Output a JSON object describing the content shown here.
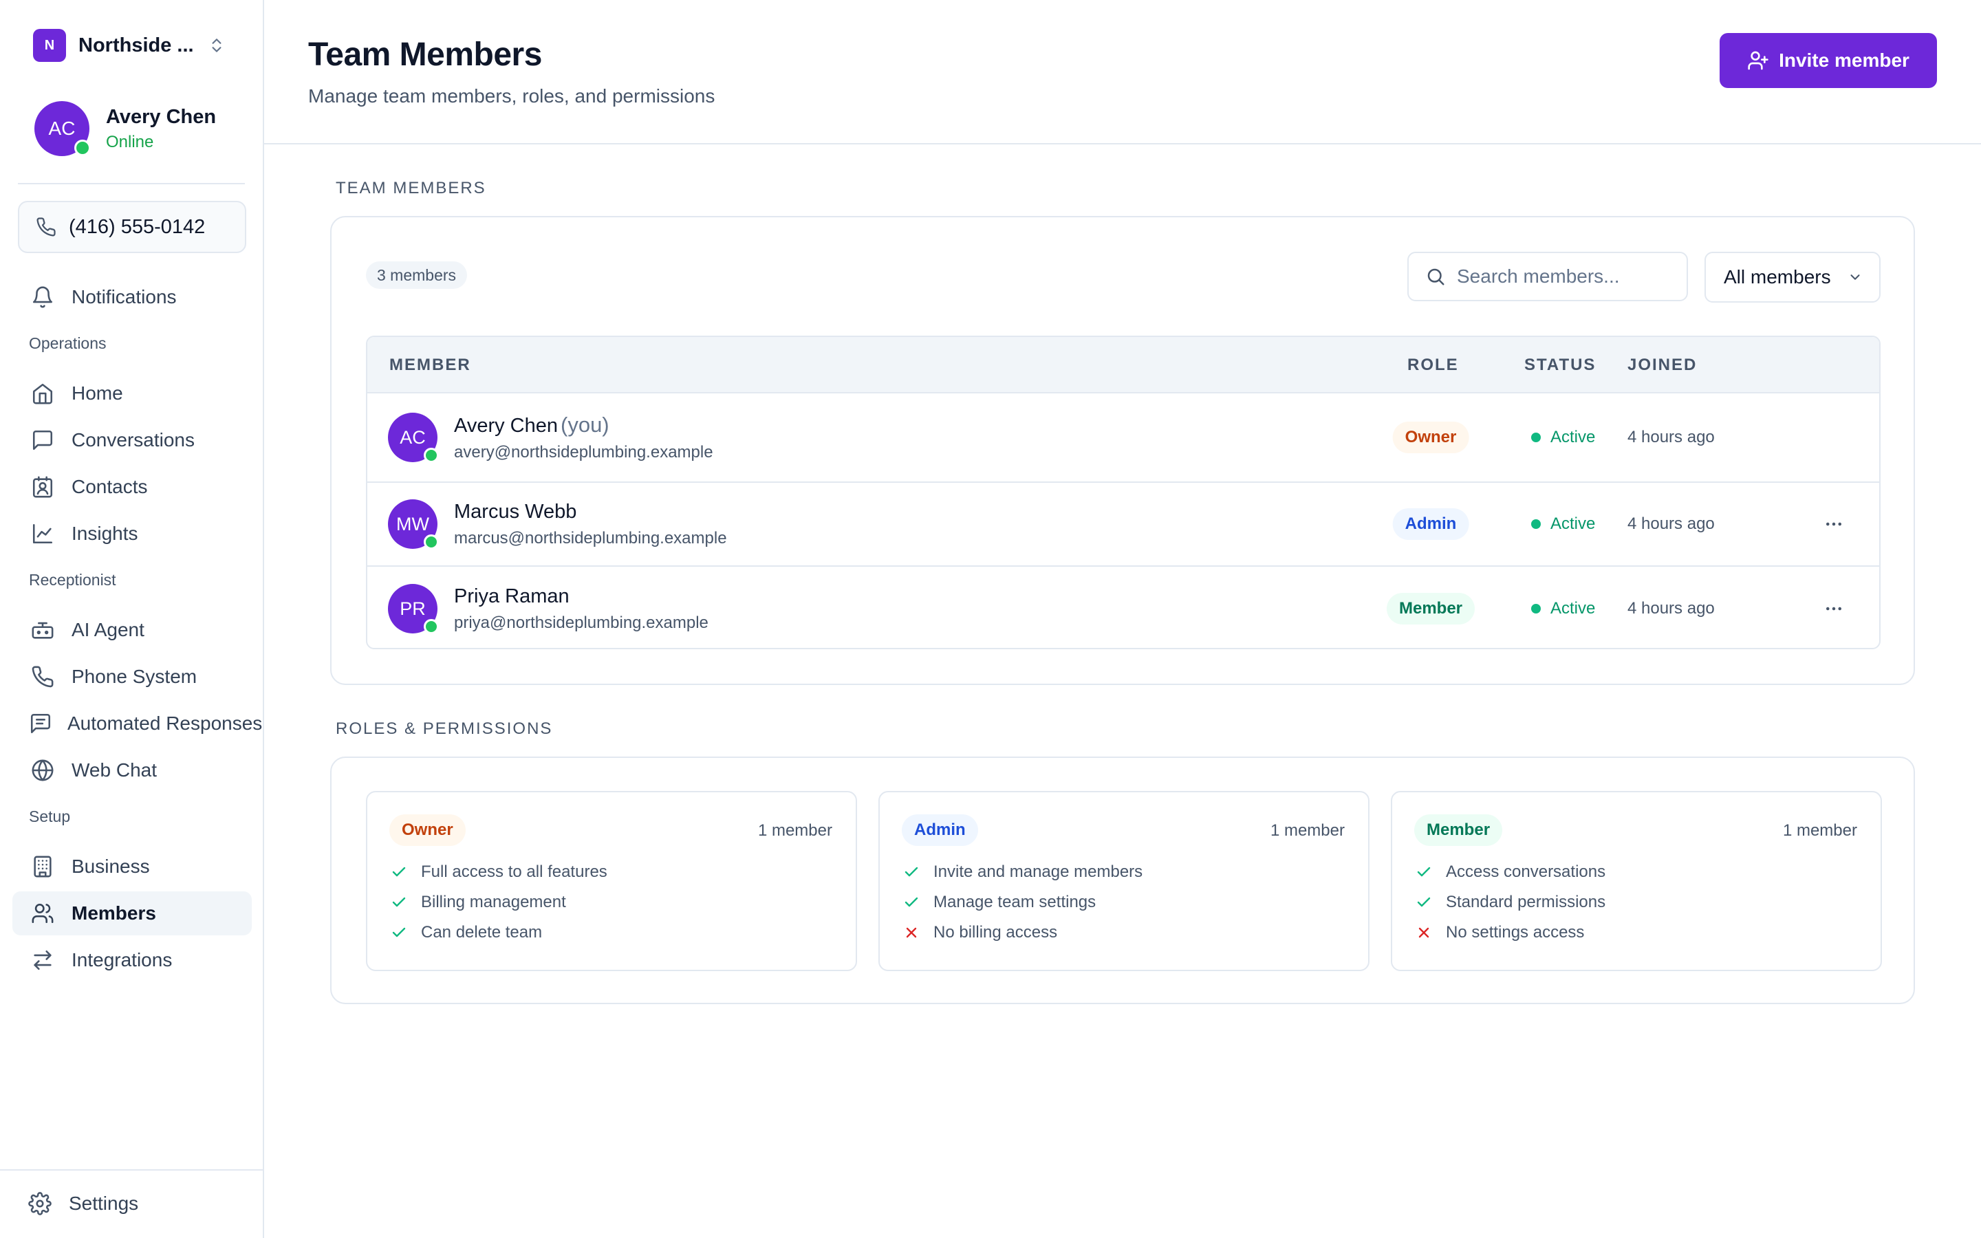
{
  "org": {
    "initial": "N",
    "name": "Northside ..."
  },
  "user": {
    "initials": "AC",
    "name": "Avery Chen",
    "status": "Online"
  },
  "phone": {
    "number": "(416) 555-0142"
  },
  "nav": {
    "notifications": "Notifications",
    "sections": {
      "operations": "Operations",
      "receptionist": "Receptionist",
      "setup": "Setup"
    },
    "items": {
      "home": "Home",
      "conversations": "Conversations",
      "contacts": "Contacts",
      "insights": "Insights",
      "ai_agent": "AI Agent",
      "phone_system": "Phone System",
      "automated_responses": "Automated Responses",
      "web_chat": "Web Chat",
      "business": "Business",
      "members": "Members",
      "integrations": "Integrations"
    },
    "settings": "Settings",
    "active": "members"
  },
  "header": {
    "title": "Team Members",
    "subtitle": "Manage team members, roles, and permissions",
    "invite_label": "Invite member"
  },
  "team": {
    "section_label": "TEAM MEMBERS",
    "count_label": "3 members",
    "search_placeholder": "Search members...",
    "filter_value": "All members",
    "columns": {
      "member": "MEMBER",
      "role": "ROLE",
      "status": "STATUS",
      "joined": "JOINED"
    },
    "rows": [
      {
        "initials": "AC",
        "name": "Avery Chen",
        "you": "(you)",
        "email": "avery@northsideplumbing.example",
        "role": "Owner",
        "status": "Active",
        "joined": "4 hours ago"
      },
      {
        "initials": "MW",
        "name": "Marcus Webb",
        "you": "",
        "email": "marcus@northsideplumbing.example",
        "role": "Admin",
        "status": "Active",
        "joined": "4 hours ago"
      },
      {
        "initials": "PR",
        "name": "Priya Raman",
        "you": "",
        "email": "priya@northsideplumbing.example",
        "role": "Member",
        "status": "Active",
        "joined": "4 hours ago"
      }
    ]
  },
  "roles": {
    "section_label": "ROLES & PERMISSIONS",
    "cards": [
      {
        "name": "Owner",
        "count": "1 member",
        "perms": [
          {
            "text": "Full access to all features",
            "allowed": true
          },
          {
            "text": "Billing management",
            "allowed": true
          },
          {
            "text": "Can delete team",
            "allowed": true
          }
        ]
      },
      {
        "name": "Admin",
        "count": "1 member",
        "perms": [
          {
            "text": "Invite and manage members",
            "allowed": true
          },
          {
            "text": "Manage team settings",
            "allowed": true
          },
          {
            "text": "No billing access",
            "allowed": false
          }
        ]
      },
      {
        "name": "Member",
        "count": "1 member",
        "perms": [
          {
            "text": "Access conversations",
            "allowed": true
          },
          {
            "text": "Standard permissions",
            "allowed": true
          },
          {
            "text": "No settings access",
            "allowed": false
          }
        ]
      }
    ]
  },
  "colors": {
    "accent": "#6d28d9",
    "online": "#22c55e",
    "owner": "#c2410c",
    "admin": "#1d4ed8",
    "member": "#047857",
    "check": "#10b981",
    "cross": "#dc2626"
  }
}
